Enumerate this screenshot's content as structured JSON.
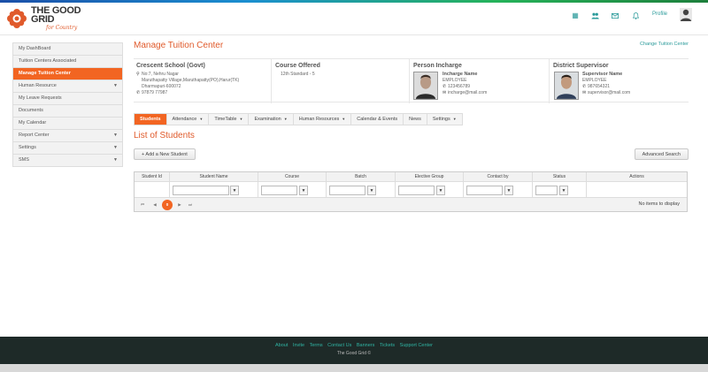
{
  "brand": {
    "name_line1": "THE GOOD",
    "name_line2": "GRID",
    "tagline": "for Country",
    "accent_color": "#f26522",
    "link_color": "#2a9a9a"
  },
  "header": {
    "icons": [
      "grid-icon",
      "users-icon",
      "mail-icon",
      "bell-icon"
    ],
    "profile_label": "Profile"
  },
  "sidebar": {
    "items": [
      {
        "label": "My DashBoard",
        "has_caret": false
      },
      {
        "label": "Tuition Centers Associated",
        "has_caret": false
      },
      {
        "label": "Manage Tuition Center",
        "has_caret": false,
        "active": true
      },
      {
        "label": "Human Resource",
        "has_caret": true
      },
      {
        "label": "My Leave Requests",
        "has_caret": false
      },
      {
        "label": "Documents",
        "has_caret": false
      },
      {
        "label": "My Calendar",
        "has_caret": false
      },
      {
        "label": "Report Center",
        "has_caret": true
      },
      {
        "label": "Settings",
        "has_caret": true
      },
      {
        "label": "SMS",
        "has_caret": true
      }
    ]
  },
  "main": {
    "title": "Manage Tuition Center",
    "change_link": "Change Tuition Center"
  },
  "info": {
    "school": {
      "name": "Crescent School (Govt)",
      "addr1": "No:7, Nehru Nagar",
      "addr2": "Maruthapatty Village,Maruthapatty(PO),Harur(TK)",
      "addr3": "Dharmapuri-600072",
      "phone": "97879 77987"
    },
    "course": {
      "heading": "Course Offered",
      "value": "12th Standard - 5"
    },
    "incharge": {
      "heading": "Person Incharge",
      "name": "Incharge Name",
      "role": "EMPLOYEE",
      "phone": "123456789",
      "email": "incharge@mail.com"
    },
    "supervisor": {
      "heading": "District Supervisor",
      "name": "Supervisor Name",
      "role": "EMPLOYEE",
      "phone": "987654321",
      "email": "supervisor@mail.com"
    }
  },
  "tabs": [
    {
      "label": "Students",
      "dropdown": false,
      "active": true
    },
    {
      "label": "Attendance",
      "dropdown": true
    },
    {
      "label": "TimeTable",
      "dropdown": true
    },
    {
      "label": "Examination",
      "dropdown": true
    },
    {
      "label": "Human Resources",
      "dropdown": true
    },
    {
      "label": "Calendar & Events",
      "dropdown": false
    },
    {
      "label": "News",
      "dropdown": false
    },
    {
      "label": "Settings",
      "dropdown": true
    }
  ],
  "list": {
    "title": "List of Students",
    "add_button": "+ Add a New Student",
    "advanced_search": "Advanced Search",
    "columns": [
      "Student Id",
      "Student Name",
      "Course",
      "Batch",
      "Elective Group",
      "Contact by",
      "Status",
      "Actions"
    ],
    "pager": {
      "first": "⏮",
      "prev": "◀",
      "current": "0",
      "next": "▶",
      "last": "⏭"
    },
    "empty_text": "No items to display"
  },
  "footer": {
    "links": [
      "About",
      "Invite",
      "Terms",
      "Contact Us",
      "Banners",
      "Tickets",
      "Support Center"
    ],
    "copyright": "The Good Grid ©"
  }
}
